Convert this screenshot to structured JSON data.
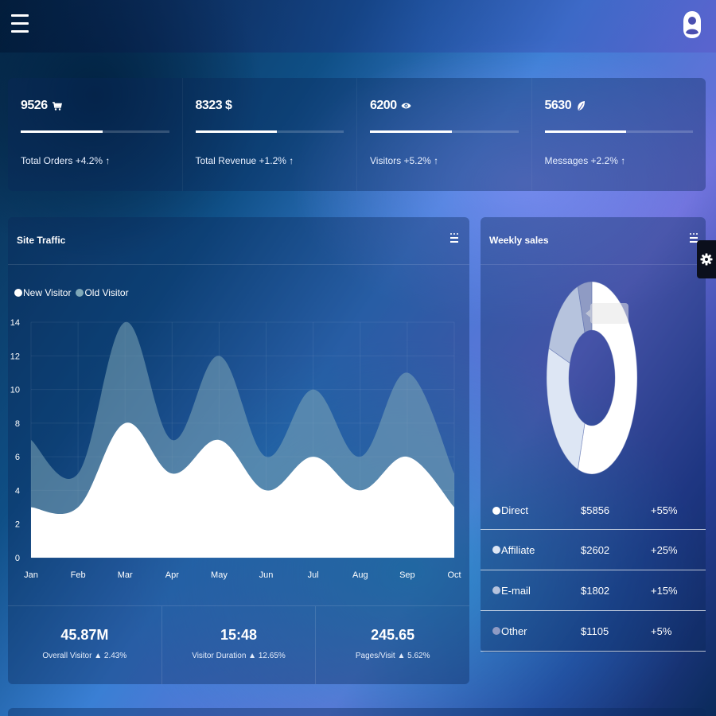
{
  "topbar": {
    "menu_icon": "hamburger-menu-icon",
    "user_icon": "user-avatar-icon"
  },
  "stats": [
    {
      "value": "9526",
      "icon": "cart-icon",
      "progress": 0.55,
      "label": "Total Orders +4.2% ↑"
    },
    {
      "value": "8323 $",
      "icon": "",
      "progress": 0.55,
      "label": "Total Revenue +1.2% ↑"
    },
    {
      "value": "6200",
      "icon": "eye-icon",
      "progress": 0.55,
      "label": "Visitors +5.2% ↑"
    },
    {
      "value": "5630",
      "icon": "leaf-icon",
      "progress": 0.55,
      "label": "Messages +2.2% ↑"
    }
  ],
  "site_traffic": {
    "title": "Site Traffic",
    "legend": [
      {
        "label": "New Visitor",
        "color": "#ffffff"
      },
      {
        "label": "Old Visitor",
        "color": "#7fa8b8"
      }
    ],
    "footer": [
      {
        "value": "45.87M",
        "label": "Overall Visitor ▲ 2.43%"
      },
      {
        "value": "15:48",
        "label": "Visitor Duration ▲ 12.65%"
      },
      {
        "value": "245.65",
        "label": "Pages/Visit ▲ 5.62%"
      }
    ]
  },
  "chart_data": {
    "type": "area",
    "title": "Site Traffic",
    "categories": [
      "Jan",
      "Feb",
      "Mar",
      "Apr",
      "May",
      "Jun",
      "Jul",
      "Aug",
      "Sep",
      "Oct"
    ],
    "ylim": [
      0,
      14
    ],
    "yticks": [
      0,
      2,
      4,
      6,
      8,
      10,
      12,
      14
    ],
    "grid": true,
    "legend_position": "top-left",
    "series": [
      {
        "name": "Old Visitor",
        "values": [
          7,
          5,
          14,
          7,
          12,
          6,
          10,
          6,
          11,
          5
        ],
        "color": "#7fa8b8"
      },
      {
        "name": "New Visitor",
        "values": [
          3,
          3,
          8,
          5,
          7,
          4,
          6,
          4,
          6,
          3
        ],
        "color": "#ffffff"
      }
    ]
  },
  "weekly_sales": {
    "title": "Weekly sales",
    "donut": {
      "type": "pie",
      "slices": [
        {
          "name": "Direct",
          "value": 55,
          "color": "#ffffff"
        },
        {
          "name": "Affiliate",
          "value": 25,
          "color": "#dde6f4"
        },
        {
          "name": "E-mail",
          "value": 15,
          "color": "#b6c3dd"
        },
        {
          "name": "Other",
          "value": 5,
          "color": "#8f9bc4"
        }
      ]
    },
    "rows": [
      {
        "name": "Direct",
        "amount": "$5856",
        "pct": "+55%",
        "color": "#ffffff"
      },
      {
        "name": "Affiliate",
        "amount": "$2602",
        "pct": "+25%",
        "color": "#dde6f4"
      },
      {
        "name": "E-mail",
        "amount": "$1802",
        "pct": "+15%",
        "color": "#b6c3dd"
      },
      {
        "name": "Other",
        "amount": "$1105",
        "pct": "+5%",
        "color": "#8f9bc4"
      }
    ]
  },
  "settings_tab": {
    "icon": "gear-icon"
  }
}
